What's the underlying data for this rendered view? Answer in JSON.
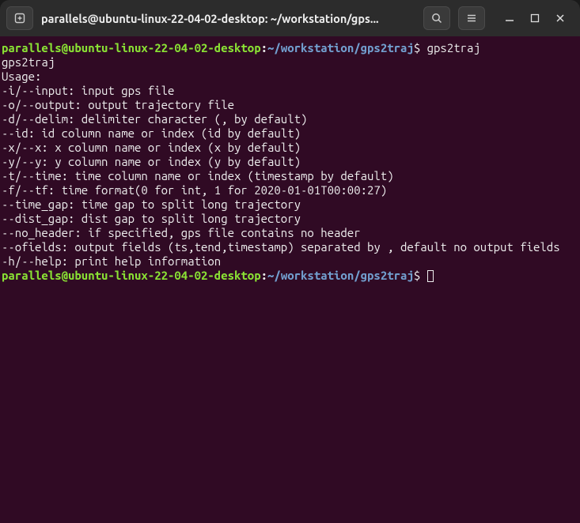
{
  "titlebar": {
    "title": "parallels@ubuntu-linux-22-04-02-desktop: ~/workstation/gps..."
  },
  "prompt": {
    "user_host": "parallels@ubuntu-linux-22-04-02-desktop",
    "colon": ":",
    "path": "~/workstation/gps2traj",
    "dollar": "$"
  },
  "session": {
    "cmd1": " gps2traj",
    "output": [
      "gps2traj",
      "Usage:",
      "-i/--input: input gps file",
      "-o/--output: output trajectory file",
      "-d/--delim: delimiter character (, by default)",
      "--id: id column name or index (id by default)",
      "-x/--x: x column name or index (x by default)",
      "-y/--y: y column name or index (y by default)",
      "-t/--time: time column name or index (timestamp by default)",
      "-f/--tf: time format(0 for int, 1 for 2020-01-01T00:00:27)",
      "--time_gap: time gap to split long trajectory",
      "--dist_gap: dist gap to split long trajectory",
      "--no_header: if specified, gps file contains no header",
      "--ofields: output fields (ts,tend,timestamp) separated by , default no output fields",
      "-h/--help: print help information"
    ],
    "cmd2": " "
  }
}
